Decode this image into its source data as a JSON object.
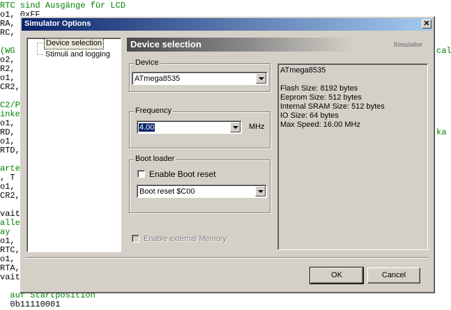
{
  "code_editor": {
    "lines": [
      {
        "text": "RTC sind Ausgänge für LCD",
        "comment": true
      },
      {
        "text": "o1, 0xFF",
        "comment": false
      },
      {
        "text": "RA,",
        "comment": false
      },
      {
        "text": "RC,",
        "comment": false
      },
      {
        "text": "",
        "comment": false
      },
      {
        "text": "(WG",
        "comment": true
      },
      {
        "text": "o2,",
        "comment": false
      },
      {
        "text": "R2,",
        "comment": false
      },
      {
        "text": "o1,",
        "comment": false
      },
      {
        "text": "CR2,",
        "comment": false
      },
      {
        "text": "",
        "comment": false
      },
      {
        "text": "C2/P",
        "comment": true
      },
      {
        "text": "inke",
        "comment": true
      },
      {
        "text": "o1,",
        "comment": false
      },
      {
        "text": "RD,",
        "comment": false
      },
      {
        "text": "o1,",
        "comment": false
      },
      {
        "text": "RTD,",
        "comment": false
      },
      {
        "text": "",
        "comment": false
      },
      {
        "text": "arte",
        "comment": true
      },
      {
        "text": ", T",
        "comment": false
      },
      {
        "text": "o1,",
        "comment": false
      },
      {
        "text": "CR2,",
        "comment": false
      },
      {
        "text": "",
        "comment": false
      },
      {
        "text": "vait",
        "comment": false
      },
      {
        "text": "alle",
        "comment": true
      },
      {
        "text": "ay",
        "comment": true
      },
      {
        "text": "o1,",
        "comment": false
      },
      {
        "text": "RTC,",
        "comment": false
      },
      {
        "text": "o1,",
        "comment": false
      },
      {
        "text": "RTA,",
        "comment": false
      },
      {
        "text": "vait",
        "comment": false
      },
      {
        "text": "",
        "comment": false
      },
      {
        "text": "  auf Startposition",
        "comment": true
      },
      {
        "text": "  0b11110001",
        "comment": false
      }
    ],
    "right_fragments": [
      "cal",
      "ka"
    ]
  },
  "dialog": {
    "title": "Simulator Options",
    "close_glyph": "✕",
    "tree": {
      "items": [
        "Device selection",
        "Stimuli and logging"
      ]
    },
    "header": {
      "title": "Device selection",
      "subtitle": "Simulator"
    },
    "device": {
      "legend": "Device",
      "selected": "ATmega8535"
    },
    "frequency": {
      "legend": "Frequency",
      "value": "4.00",
      "unit": "MHz"
    },
    "bootloader": {
      "legend": "Boot loader",
      "enable_label": "Enable Boot reset",
      "selected": "Boot reset $C00"
    },
    "external_memory": {
      "label": "Enable external Memory"
    },
    "info": {
      "name": "ATmega8535",
      "lines": [
        "Flash Size: 8192 bytes",
        "Eeprom Size: 512 bytes",
        "Internal SRAM Size: 512 bytes",
        "IO Size: 64 bytes",
        "Max Speed: 16.00 MHz"
      ]
    },
    "buttons": {
      "ok": "OK",
      "cancel": "Cancel"
    }
  }
}
